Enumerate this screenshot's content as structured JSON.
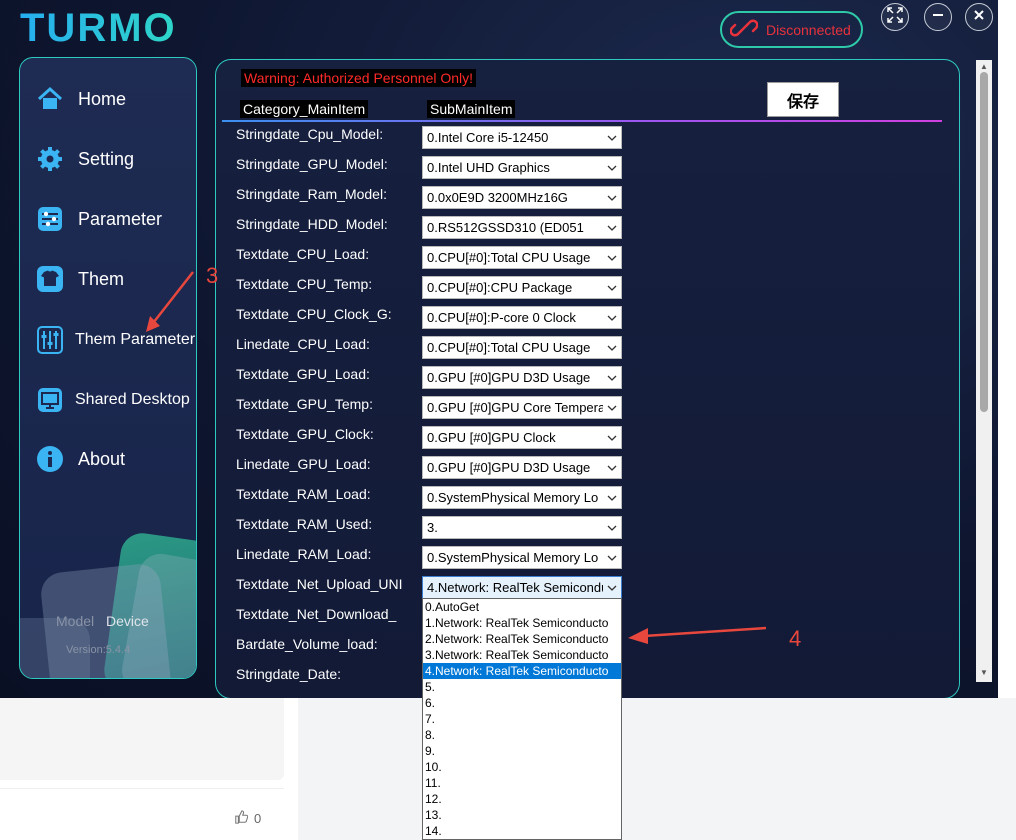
{
  "app": {
    "logo": "TURMO",
    "connection_status": "Disconnected",
    "window_controls": [
      "fullscreen-icon",
      "minimize-icon",
      "close-icon"
    ]
  },
  "sidebar": {
    "items": [
      {
        "label": "Home",
        "icon": "home-icon"
      },
      {
        "label": "Setting",
        "icon": "gear-icon"
      },
      {
        "label": "Parameter",
        "icon": "sliders-icon"
      },
      {
        "label": "Them",
        "icon": "tshirt-icon"
      },
      {
        "label": "Them Parameter",
        "icon": "tune-icon"
      },
      {
        "label": "Shared Desktop",
        "icon": "desktop-icon"
      },
      {
        "label": "About",
        "icon": "info-icon"
      }
    ],
    "model_label": "Model",
    "device_label": "Device",
    "version": "Version:5.4.4"
  },
  "panel": {
    "warning": "Warning: Authorized Personnel Only!",
    "col_category": "Category_MainItem",
    "col_sub": "SubMainItem",
    "save_label": "保存",
    "rows": [
      {
        "label": "Stringdate_Cpu_Model:",
        "value": "0.Intel Core i5-12450"
      },
      {
        "label": "Stringdate_GPU_Model:",
        "value": "0.Intel UHD Graphics"
      },
      {
        "label": "Stringdate_Ram_Model:",
        "value": "0.0x0E9D 3200MHz16G"
      },
      {
        "label": "Stringdate_HDD_Model:",
        "value": "0.RS512GSSD310 (ED051"
      },
      {
        "label": "Textdate_CPU_Load:",
        "value": "0.CPU[#0]:Total CPU Usage"
      },
      {
        "label": "Textdate_CPU_Temp:",
        "value": "0.CPU[#0]:CPU Package"
      },
      {
        "label": "Textdate_CPU_Clock_G:",
        "value": "0.CPU[#0]:P-core 0 Clock"
      },
      {
        "label": "Linedate_CPU_Load:",
        "value": "0.CPU[#0]:Total CPU Usage"
      },
      {
        "label": "Textdate_GPU_Load:",
        "value": "0.GPU [#0]GPU D3D Usage"
      },
      {
        "label": "Textdate_GPU_Temp:",
        "value": "0.GPU [#0]GPU Core Tempera"
      },
      {
        "label": "Textdate_GPU_Clock:",
        "value": "0.GPU [#0]GPU Clock"
      },
      {
        "label": "Linedate_GPU_Load:",
        "value": "0.GPU [#0]GPU D3D Usage"
      },
      {
        "label": "Textdate_RAM_Load:",
        "value": "0.SystemPhysical Memory Lo"
      },
      {
        "label": "Textdate_RAM_Used:",
        "value": "3."
      },
      {
        "label": "Linedate_RAM_Load:",
        "value": "0.SystemPhysical Memory Lo"
      },
      {
        "label": "Textdate_Net_Upload_UNI",
        "value": "4.Network: RealTek Semicondu"
      },
      {
        "label": "Textdate_Net_Download_",
        "value": ""
      },
      {
        "label": "Bardate_Volume_load:",
        "value": ""
      },
      {
        "label": "Stringdate_Date:",
        "value": ""
      }
    ]
  },
  "dropdown": {
    "options": [
      "0.AutoGet",
      "1.Network: RealTek Semiconducto",
      "2.Network: RealTek Semiconducto",
      "3.Network: RealTek Semiconducto",
      "4.Network: RealTek Semiconducto",
      "5.",
      "6.",
      "7.",
      "8.",
      "9.",
      "10.",
      "11.",
      "12.",
      "13.",
      "14."
    ],
    "selected_index": 4
  },
  "annotations": {
    "step3": "3",
    "step4": "4",
    "color": "#e8473d"
  },
  "background_page": {
    "like_count": "0"
  }
}
